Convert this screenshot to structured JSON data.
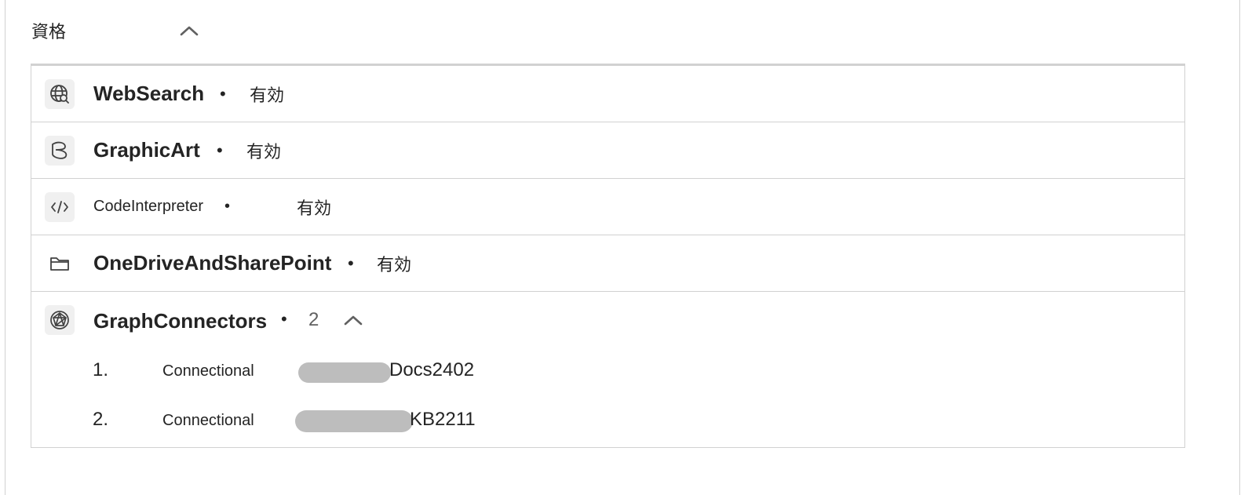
{
  "section": {
    "title": "資格",
    "collapse_icon": "chevron-up-icon"
  },
  "capabilities": [
    {
      "name": "WebSearch",
      "separator": "•",
      "status": "有効",
      "icon": "globe-search-icon"
    },
    {
      "name": "GraphicArt",
      "separator": "•",
      "status": "有効",
      "icon": "graphic-art-icon"
    },
    {
      "name": "CodeInterpreter",
      "separator": "•",
      "status": "有効",
      "icon": "code-icon"
    },
    {
      "name": "OneDriveAndSharePoint",
      "separator": "•",
      "status": "有効",
      "icon": "folder-icon"
    }
  ],
  "graph_connectors": {
    "name": "GraphConnectors",
    "separator": "•",
    "count": "2",
    "icon": "graph-connector-icon",
    "expand_icon": "chevron-up-icon",
    "items": [
      {
        "number": "1.",
        "label": "Connectional",
        "value": "Docs2402"
      },
      {
        "number": "2.",
        "label": "Connectional",
        "value": "KB2211"
      }
    ]
  },
  "colors": {
    "text": "#242424",
    "border": "#d1d1d1",
    "icon_bg": "#f0f0f0",
    "redaction": "#bdbdbd"
  }
}
